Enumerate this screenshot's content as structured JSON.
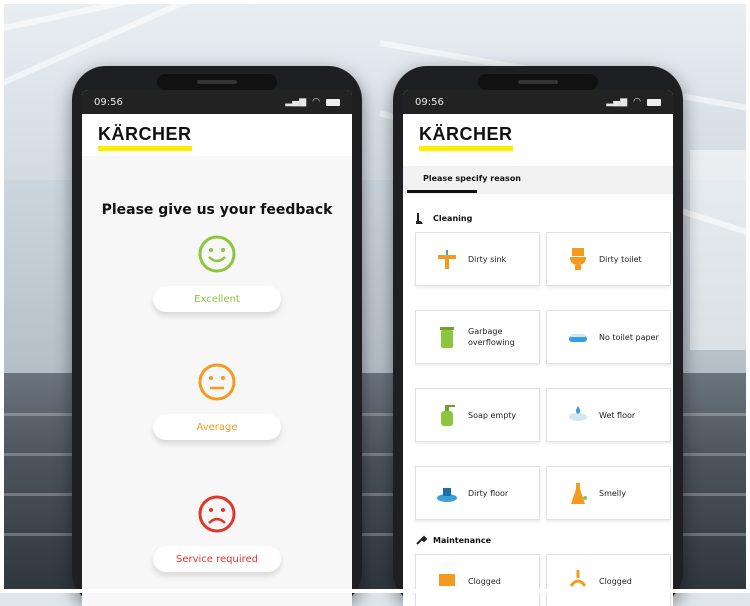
{
  "colors": {
    "brand_yellow": "#ffed00",
    "excellent": "#8cc63f",
    "average": "#f39a1f",
    "service": "#e2352c",
    "status_bar": "#222222"
  },
  "left_phone": {
    "status": {
      "time": "09:56",
      "icons": [
        "signal-icon",
        "wifi-icon",
        "battery-icon"
      ]
    },
    "logo": "KÄRCHER",
    "title": "Please give us your feedback",
    "ratings": [
      {
        "label": "Excellent",
        "icon": "smile-face-icon"
      },
      {
        "label": "Average",
        "icon": "neutral-face-icon"
      },
      {
        "label": "Service required",
        "icon": "sad-face-icon"
      }
    ]
  },
  "right_phone": {
    "status": {
      "time": "09:56",
      "icons": [
        "signal-icon",
        "wifi-icon",
        "battery-icon"
      ]
    },
    "logo": "KÄRCHER",
    "tab": "Please specify reason",
    "sections": [
      {
        "title": "Cleaning",
        "icon": "cleaning-icon"
      },
      {
        "title": "Maintenance",
        "icon": "wrench-icon"
      }
    ],
    "cleaning_items": [
      {
        "label": "Dirty sink",
        "icon": "sink-icon"
      },
      {
        "label": "Dirty toilet",
        "icon": "toilet-icon"
      },
      {
        "label": "Garbage overflowing",
        "icon": "garbage-bin-icon"
      },
      {
        "label": "No toilet paper",
        "icon": "toilet-paper-icon"
      },
      {
        "label": "Soap empty",
        "icon": "soap-dispenser-icon"
      },
      {
        "label": "Wet floor",
        "icon": "wet-floor-icon"
      },
      {
        "label": "Dirty floor",
        "icon": "dirty-floor-icon"
      },
      {
        "label": "Smelly",
        "icon": "smell-icon"
      }
    ],
    "maintenance_items": [
      {
        "label": "Clogged",
        "icon": "clogged-sink-icon"
      },
      {
        "label": "Clogged",
        "icon": "clogged-toilet-icon"
      }
    ]
  }
}
